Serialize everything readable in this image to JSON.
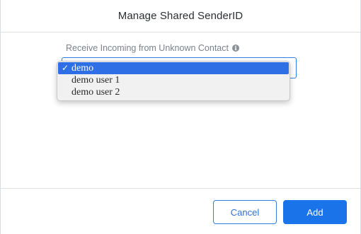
{
  "dialog": {
    "title": "Manage Shared SenderID"
  },
  "form": {
    "label": "Receive Incoming from Unknown Contact",
    "info_icon": "i",
    "selected_value": "demo"
  },
  "dropdown": {
    "check_mark": "✓",
    "options": [
      {
        "label": "demo",
        "selected": true
      },
      {
        "label": "demo user 1",
        "selected": false
      },
      {
        "label": "demo user 2",
        "selected": false
      }
    ]
  },
  "footer": {
    "cancel_label": "Cancel",
    "add_label": "Add"
  },
  "colors": {
    "primary": "#1a73e8",
    "selection": "#2f6fe6"
  }
}
